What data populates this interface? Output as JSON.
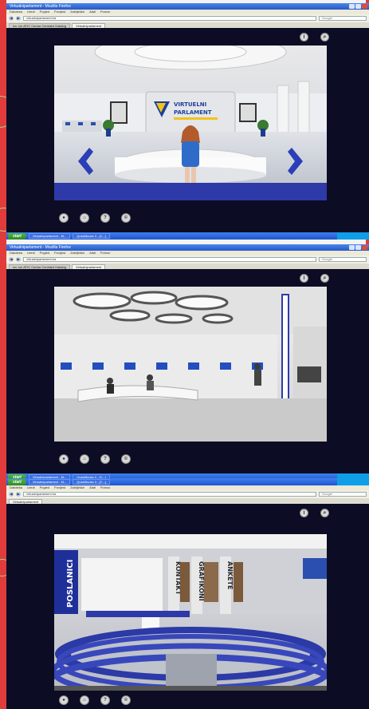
{
  "colors": {
    "window_title": "#2658c8",
    "taskbar": "#2b66dd",
    "screen_bg": "#0c0c24",
    "accent_blue": "#2e3aa8",
    "border_red": "#e23b3b"
  },
  "browser": {
    "window_title": "Virtualniparlament - Mozilla Firefox",
    "menu": [
      "Datoteka",
      "Uredi",
      "Pogled",
      "Povijest",
      "Zabilješke",
      "Alati",
      "Pomoć"
    ],
    "url": "virtualniparlament.ba",
    "search_placeholder": "Google",
    "tab_label": "Virtualniparlament"
  },
  "panels": [
    {
      "tab_extra": "Izv. Izn ATIC Centar Centralni Katalog"
    },
    {
      "tab_extra": "Izv. Izn ATIC Centar Centralni Katalog"
    },
    {
      "tab_extra": ""
    }
  ],
  "scene1": {
    "sign_line1": "VIRTUELNI",
    "sign_line2": "PARLAMENT"
  },
  "scene3": {
    "banners": [
      "POSLANICI",
      "KONTAKT",
      "GRAFIKONI",
      "ANKETE"
    ]
  },
  "taskbar": {
    "start_label": "start",
    "task1": "Virtualniparlament - M...",
    "task2": "QuickBooks II - [C...]"
  }
}
